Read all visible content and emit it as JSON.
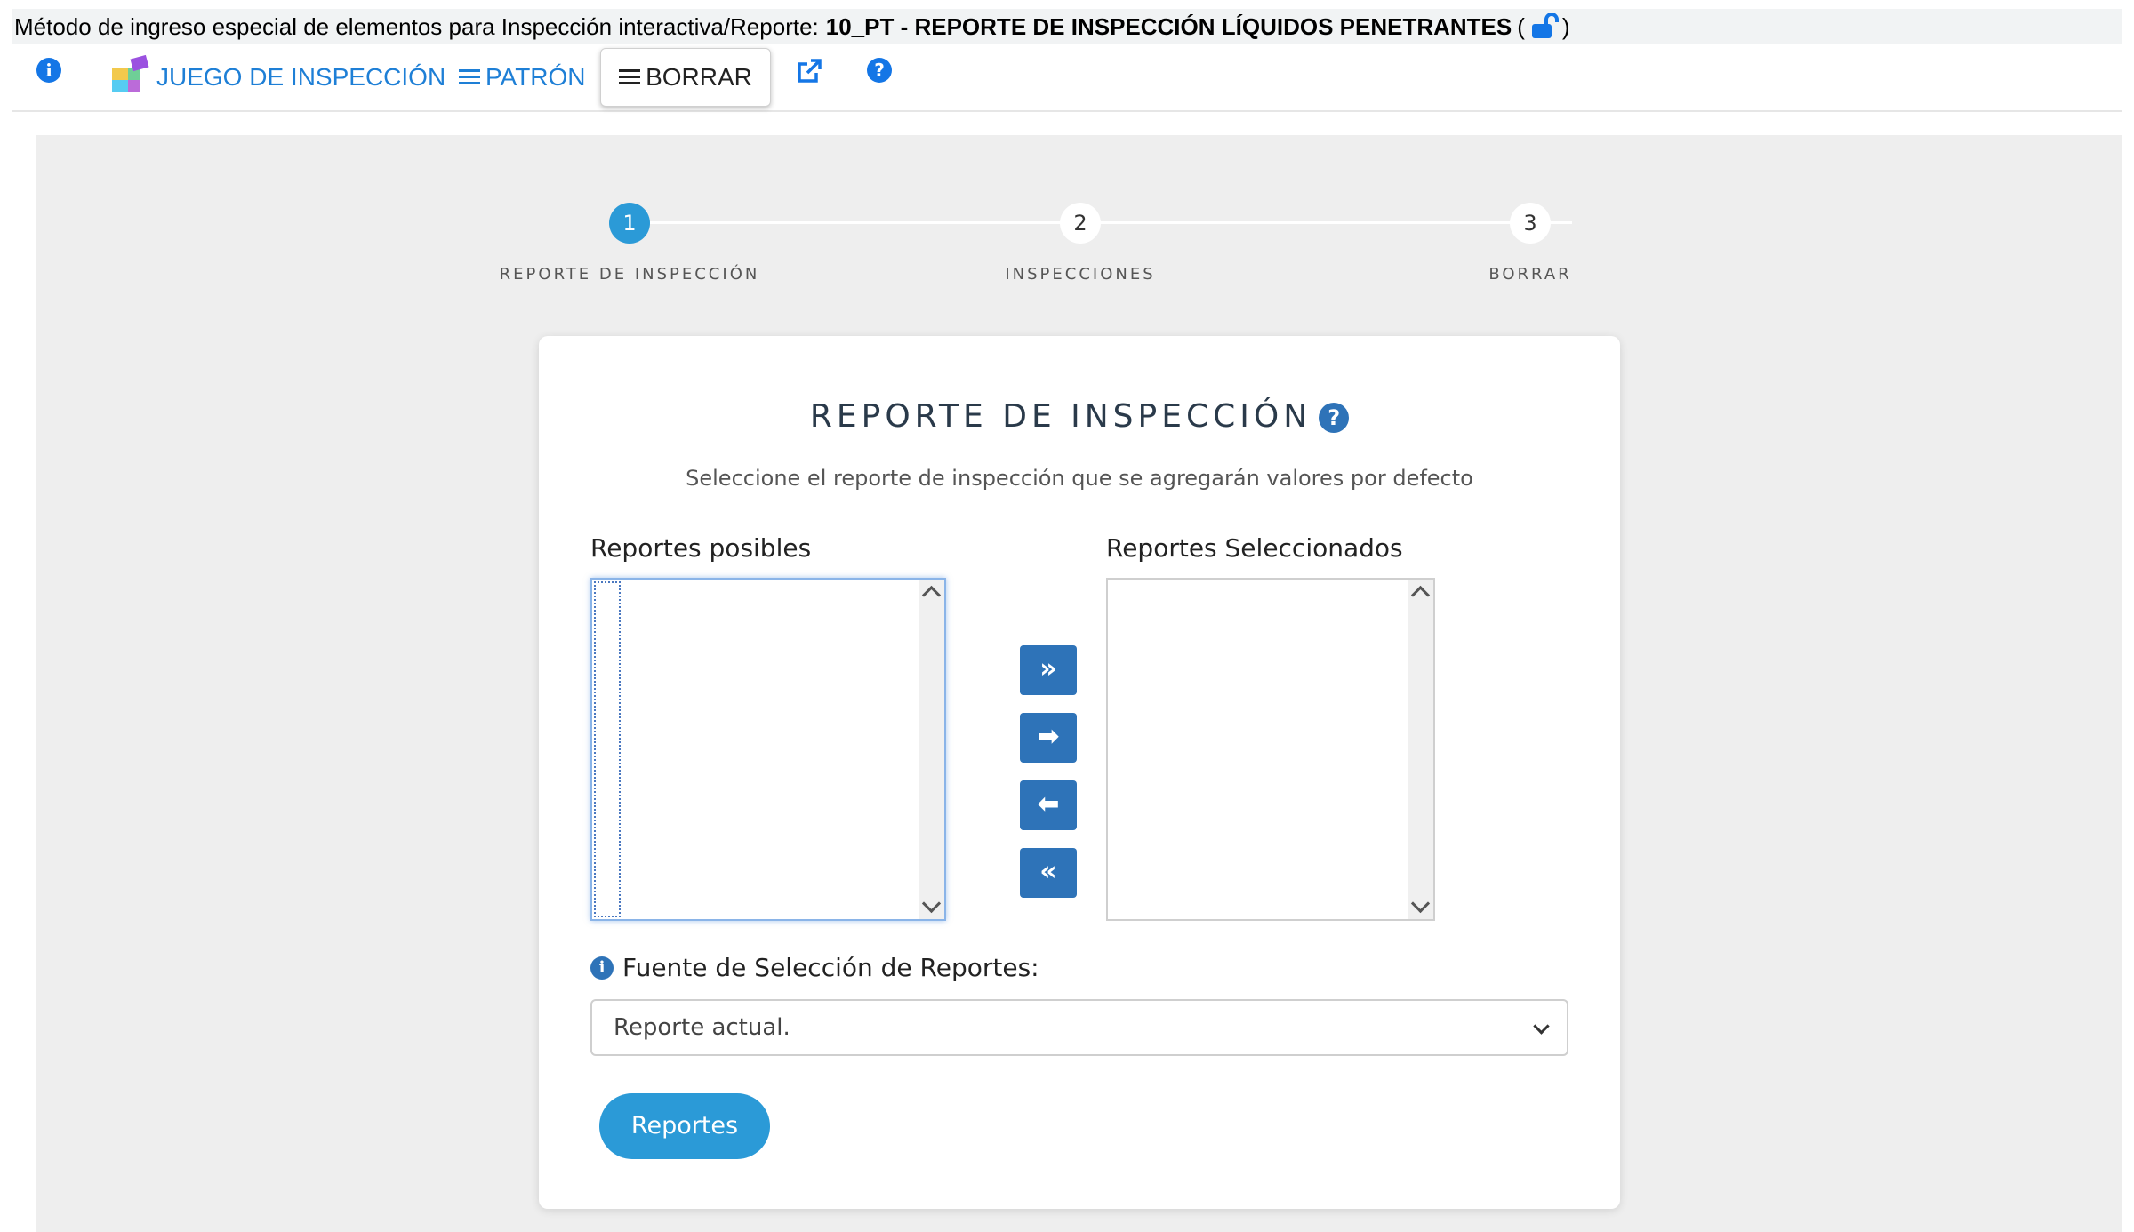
{
  "titlebar": {
    "prefix": "Método de ingreso especial de elementos para Inspección interactiva/Reporte:",
    "report_name": "10_PT - REPORTE DE INSPECCIÓN LÍQUIDOS PENETRANTES",
    "open_paren": "(",
    "close_paren": ")",
    "lock_icon": "unlocked-lock-icon"
  },
  "toolbar": {
    "info_icon": "info-icon",
    "juego_label": "JUEGO DE INSPECCIÓN",
    "patron_label": "PATRÓN",
    "borrar_label": "BORRAR",
    "external_icon": "external-link-icon",
    "help_icon": "help-icon",
    "accent_color": "#1e7fd6"
  },
  "stepper": {
    "steps": [
      {
        "num": "1",
        "label": "REPORTE DE INSPECCIÓN",
        "active": true
      },
      {
        "num": "2",
        "label": "INSPECCIONES",
        "active": false
      },
      {
        "num": "3",
        "label": "BORRAR",
        "active": false
      }
    ],
    "active_color": "#2b9ad7"
  },
  "card": {
    "title": "REPORTE DE INSPECCIÓN",
    "title_help": "?",
    "subtitle": "Seleccione el reporte de inspección que se agregarán valores por defecto",
    "left_list_label": "Reportes posibles",
    "right_list_label": "Reportes Seleccionados",
    "left_items": [],
    "right_items": [],
    "move_buttons": [
      {
        "name": "move-all-right-button",
        "glyph": "»"
      },
      {
        "name": "move-right-button",
        "glyph": "➡"
      },
      {
        "name": "move-left-button",
        "glyph": "⬅"
      },
      {
        "name": "move-all-left-button",
        "glyph": "«"
      }
    ],
    "source_label": "Fuente de Selección de Reportes:",
    "source_value": "Reporte actual.",
    "submit_label": "Reportes",
    "button_color": "#2e73b8"
  }
}
